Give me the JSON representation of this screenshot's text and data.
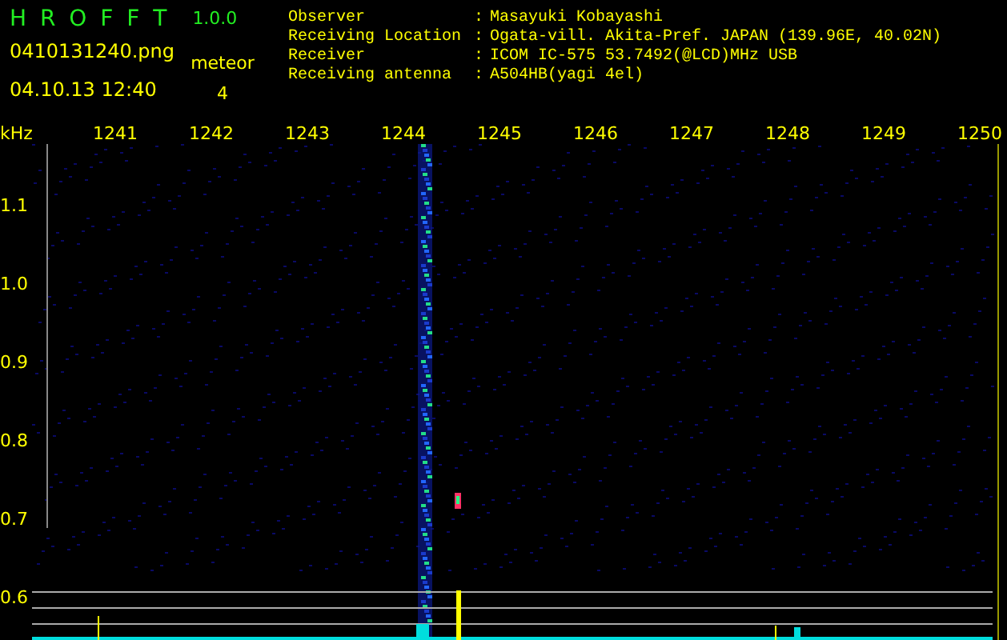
{
  "app": {
    "title": "H R O F F T",
    "version": "1.0.0"
  },
  "file": {
    "name": "0410131240.png",
    "datetime": "04.10.13 12:40"
  },
  "meteor": {
    "label": "meteor",
    "count": "4"
  },
  "info": [
    {
      "label": "Observer",
      "separator": ":",
      "value": "Masayuki Kobayashi"
    },
    {
      "label": "Receiving Location",
      "separator": ":",
      "value": "Ogata-vill. Akita-Pref. JAPAN (139.96E, 40.02N)"
    },
    {
      "label": "Receiver",
      "separator": ":",
      "value": "ICOM IC-575 53.7492(@LCD)MHz USB"
    },
    {
      "label": "Receiving antenna",
      "separator": ":",
      "value": "A504HB(yagi 4el)"
    }
  ],
  "axis": {
    "unit": "kHz",
    "x_labels": [
      "1241",
      "1242",
      "1243",
      "1244",
      "1245",
      "1246",
      "1247",
      "1248",
      "1249",
      "1250"
    ],
    "y_labels": [
      "1.1",
      "1.0",
      "0.9",
      "0.8",
      "0.7",
      "0.6"
    ]
  }
}
